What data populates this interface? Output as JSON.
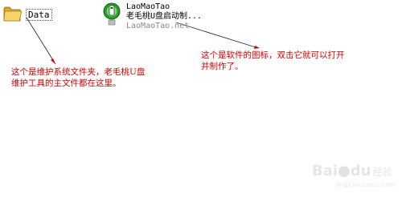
{
  "desktop": {
    "folder": {
      "label": "Data",
      "icon": "folder-icon"
    },
    "app": {
      "name": "LaoMaoTao",
      "description": "老毛桃U盘启动制...",
      "publisher": "LaoMaoTao.net",
      "icon": "laomaotao-app-icon"
    }
  },
  "annotations": {
    "left": {
      "line1": "这个是维护系统文件夹，老毛桃U盘",
      "line2": "维护工具的主文件都在这里。"
    },
    "right": {
      "line1": "这个是软件的图标，双击它就可以打开",
      "line2": "并制作了。"
    },
    "arrow_color": "#cc0000",
    "text_color": "#d40000"
  },
  "watermark": {
    "brand": "Bai",
    "brand_tail": "du",
    "suffix": "经验",
    "url": "jingyan.baidu.com"
  }
}
